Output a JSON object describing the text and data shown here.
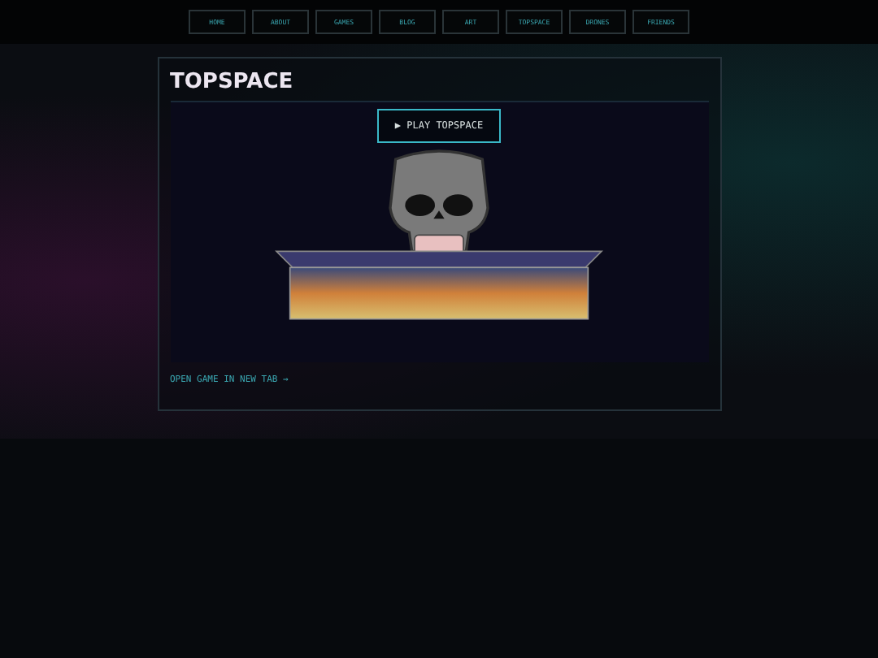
{
  "nav": [
    "HOME",
    "ABOUT",
    "GAMES",
    "BLOG",
    "ART",
    "TOPSPACE",
    "DRONES",
    "FRIENDS"
  ],
  "title": "TOPSPACE",
  "play_button": "▶ PLAY TOPSPACE",
  "link": "OPEN GAME IN NEW TAB →"
}
